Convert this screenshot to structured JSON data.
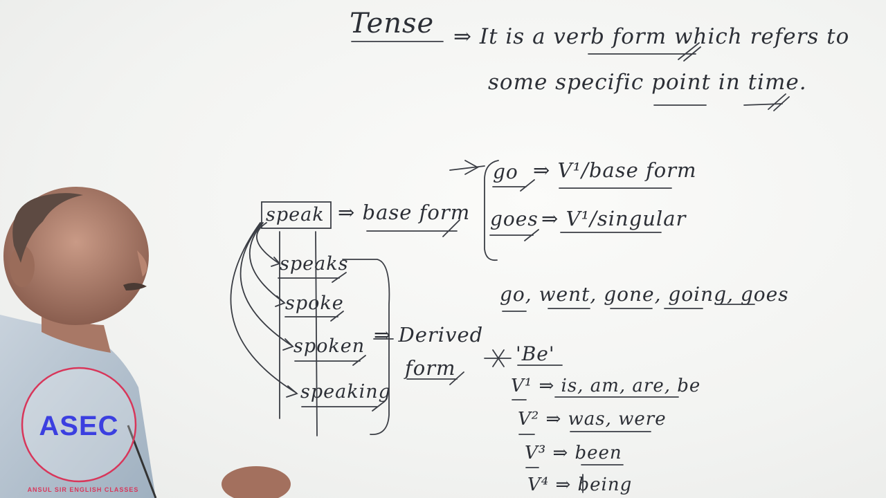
{
  "definition": {
    "term": "Tense",
    "line1": "⇒ It is a verb form which refers to",
    "line2": "some specific point in time."
  },
  "diagram": {
    "base_word": "speak",
    "base_label": "⇒ base form",
    "derived_forms": [
      "speaks",
      "spoke",
      "spoken",
      "speaking"
    ],
    "derived_label_1": "⇒ Derived",
    "derived_label_2": "form"
  },
  "go_section": {
    "go": "go",
    "go_label": "⇒ V¹/base form",
    "goes": "goes",
    "goes_label": "⇒ V¹/singular",
    "forms_list": "go, went, gone, going, goes"
  },
  "be_section": {
    "heading": "'Be'",
    "v1": "V¹ ⇒ is, am, are, be",
    "v2": "V² ⇒ was, were",
    "v3": "V³ ⇒ been",
    "v4": "V⁴ ⇒ being"
  },
  "logo": {
    "text": "ASEC",
    "subtext": "ANSUL SIR ENGLISH CLASSES",
    "ring_color": "#d8365a",
    "text_color": "#3b3fe0"
  }
}
